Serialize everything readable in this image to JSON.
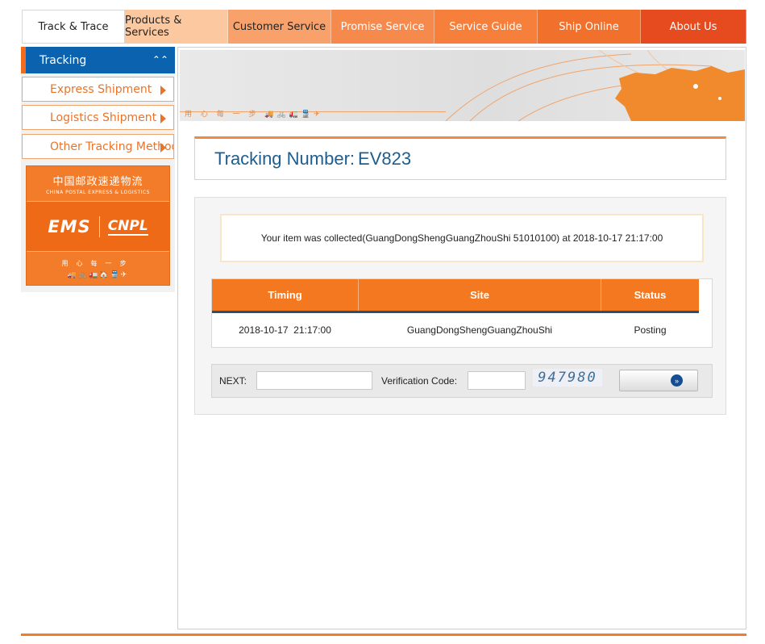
{
  "nav": {
    "tabs": [
      {
        "label": "Track & Trace"
      },
      {
        "label": "Products & Services"
      },
      {
        "label": "Customer Service"
      },
      {
        "label": "Promise Service"
      },
      {
        "label": "Service Guide"
      },
      {
        "label": "Ship Online"
      },
      {
        "label": "About Us"
      }
    ]
  },
  "sidebar": {
    "header": "Tracking",
    "items": [
      {
        "label": "Express Shipment"
      },
      {
        "label": "Logistics Shipment"
      },
      {
        "label": "Other Tracking Methods"
      }
    ],
    "logo": {
      "cn_text": "中国邮政速递物流",
      "en_text": "CHINA POSTAL EXPRESS & LOGISTICS",
      "ems": "EMS",
      "cnpl": "CNPL",
      "motto": "用心每一步"
    }
  },
  "tracking": {
    "label": "Tracking Number:",
    "number": "EV823"
  },
  "result": {
    "message": "Your item was collected(GuangDongShengGuangZhouShi 51010100) at 2018-10-17 21:17:00",
    "columns": [
      "Timing",
      "Site",
      "Status"
    ],
    "rows": [
      {
        "timing": "2018-10-17  21:17:00",
        "site": "GuangDongShengGuangZhouShi",
        "status": "Posting"
      }
    ]
  },
  "form": {
    "next_label": "NEXT:",
    "verification_label": "Verification Code:",
    "captcha": "947980"
  },
  "colors": {
    "accent": "#f47820",
    "nav_blue": "#0b63b0",
    "title_blue": "#1d5e8e"
  }
}
